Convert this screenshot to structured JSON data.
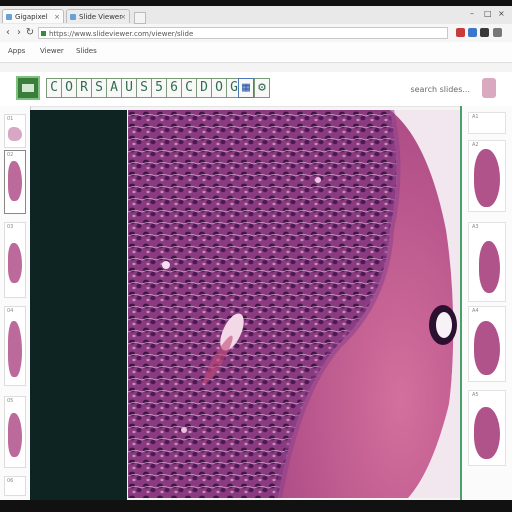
{
  "browser": {
    "tabs": [
      {
        "label": "Gigapixel",
        "active": true
      },
      {
        "label": "Slide Viewer",
        "active": false
      }
    ],
    "address_bar": {
      "url": "https://www.slideviewer.com/viewer/slide"
    },
    "bookmarks": [
      "Apps",
      "Viewer",
      "Slides"
    ]
  },
  "viewer": {
    "toolbar_buttons": [
      "C",
      "O",
      "R",
      "S",
      "A",
      "U",
      "S",
      "5",
      "6",
      "C",
      "D",
      "O",
      "G"
    ],
    "search_text": "search slides...",
    "image": {
      "type": "histology slide",
      "stain": "H&E",
      "colors": {
        "tissue_dark": "#6b2a6a",
        "tissue_mid": "#a64a8c",
        "stroma": "#c85e8e",
        "background": "#f2e6ef"
      }
    },
    "left_thumbnails": [
      "01",
      "02",
      "03",
      "04",
      "05",
      "06"
    ],
    "right_thumbnails": [
      "A1",
      "A2",
      "A3",
      "A4",
      "A5"
    ]
  },
  "colors": {
    "accent_green": "#49a16a",
    "dark_panel": "#0e2422",
    "toolbar_border": "#7a9a7a"
  }
}
